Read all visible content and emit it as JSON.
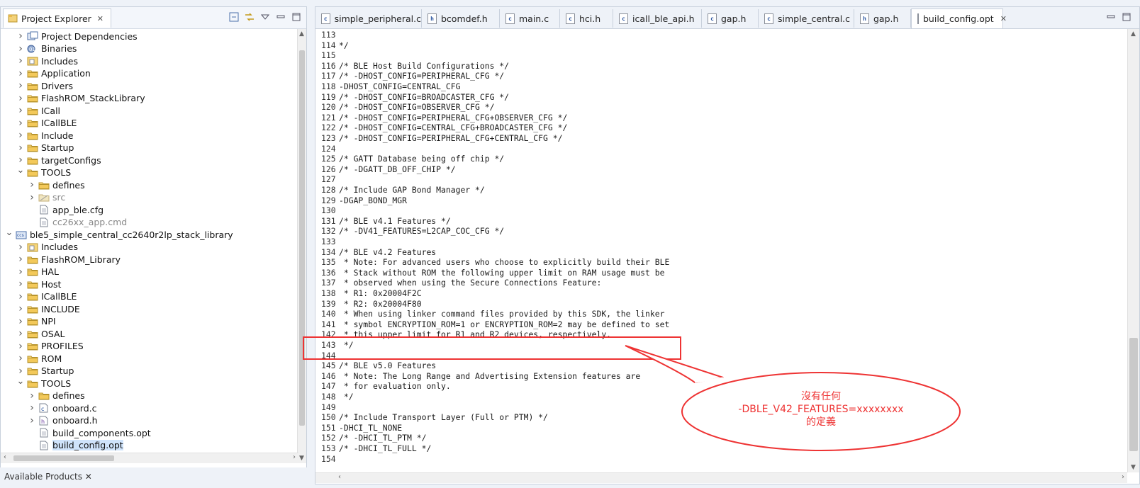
{
  "project_explorer": {
    "title": "Project Explorer",
    "close_glyph": "✕",
    "items": [
      {
        "label": "Project Dependencies",
        "icon": "dependency-icon",
        "state": "collapsed",
        "level": 1
      },
      {
        "label": "Binaries",
        "icon": "binaries-icon",
        "state": "collapsed",
        "level": 1
      },
      {
        "label": "Includes",
        "icon": "includes-icon",
        "state": "collapsed",
        "level": 1
      },
      {
        "label": "Application",
        "icon": "folder-icon",
        "state": "collapsed",
        "level": 1
      },
      {
        "label": "Drivers",
        "icon": "folder-icon",
        "state": "collapsed",
        "level": 1
      },
      {
        "label": "FlashROM_StackLibrary",
        "icon": "folder-icon",
        "state": "collapsed",
        "level": 1
      },
      {
        "label": "ICall",
        "icon": "folder-icon",
        "state": "collapsed",
        "level": 1
      },
      {
        "label": "ICallBLE",
        "icon": "folder-icon",
        "state": "collapsed",
        "level": 1
      },
      {
        "label": "Include",
        "icon": "folder-icon",
        "state": "collapsed",
        "level": 1
      },
      {
        "label": "Startup",
        "icon": "folder-icon",
        "state": "collapsed",
        "level": 1
      },
      {
        "label": "targetConfigs",
        "icon": "folder-icon",
        "state": "collapsed",
        "level": 1
      },
      {
        "label": "TOOLS",
        "icon": "folder-icon",
        "state": "expanded",
        "level": 1
      },
      {
        "label": "defines",
        "icon": "folder-icon",
        "state": "collapsed",
        "level": 2
      },
      {
        "label": "src",
        "icon": "folder-excluded-icon",
        "state": "collapsed",
        "level": 2,
        "dim": true
      },
      {
        "label": "app_ble.cfg",
        "icon": "file-icon",
        "state": "none",
        "level": 2
      },
      {
        "label": "cc26xx_app.cmd",
        "icon": "file-excluded-icon",
        "state": "none",
        "level": 2,
        "dim": true
      },
      {
        "label": "ble5_simple_central_cc2640r2lp_stack_library",
        "icon": "project-icon",
        "state": "expanded",
        "level": 0
      },
      {
        "label": "Includes",
        "icon": "includes-icon",
        "state": "collapsed",
        "level": 1
      },
      {
        "label": "FlashROM_Library",
        "icon": "folder-icon",
        "state": "collapsed",
        "level": 1
      },
      {
        "label": "HAL",
        "icon": "folder-icon",
        "state": "collapsed",
        "level": 1
      },
      {
        "label": "Host",
        "icon": "folder-icon",
        "state": "collapsed",
        "level": 1
      },
      {
        "label": "ICallBLE",
        "icon": "folder-icon",
        "state": "collapsed",
        "level": 1
      },
      {
        "label": "INCLUDE",
        "icon": "folder-icon",
        "state": "collapsed",
        "level": 1
      },
      {
        "label": "NPI",
        "icon": "folder-icon",
        "state": "collapsed",
        "level": 1
      },
      {
        "label": "OSAL",
        "icon": "folder-icon",
        "state": "collapsed",
        "level": 1
      },
      {
        "label": "PROFILES",
        "icon": "folder-icon",
        "state": "collapsed",
        "level": 1
      },
      {
        "label": "ROM",
        "icon": "folder-icon",
        "state": "collapsed",
        "level": 1
      },
      {
        "label": "Startup",
        "icon": "folder-icon",
        "state": "collapsed",
        "level": 1
      },
      {
        "label": "TOOLS",
        "icon": "folder-icon",
        "state": "expanded",
        "level": 1
      },
      {
        "label": "defines",
        "icon": "folder-icon",
        "state": "collapsed",
        "level": 2
      },
      {
        "label": "onboard.c",
        "icon": "c-file-icon",
        "state": "collapsed",
        "level": 2
      },
      {
        "label": "onboard.h",
        "icon": "h-file-icon",
        "state": "collapsed",
        "level": 2
      },
      {
        "label": "build_components.opt",
        "icon": "file-icon",
        "state": "none",
        "level": 2
      },
      {
        "label": "build_config.opt",
        "icon": "file-icon",
        "state": "none",
        "level": 2,
        "selected": true
      }
    ]
  },
  "editor": {
    "tabs": [
      {
        "label": "simple_peripheral.c",
        "icon": "c"
      },
      {
        "label": "bcomdef.h",
        "icon": "h"
      },
      {
        "label": "main.c",
        "icon": "c"
      },
      {
        "label": "hci.h",
        "icon": "c"
      },
      {
        "label": "icall_ble_api.h",
        "icon": "c"
      },
      {
        "label": "gap.h",
        "icon": "c"
      },
      {
        "label": "simple_central.c",
        "icon": "c"
      },
      {
        "label": "gap.h",
        "icon": "h"
      },
      {
        "label": "build_config.opt",
        "icon": "file",
        "active": true
      }
    ],
    "lines": [
      {
        "n": "113",
        "t": ""
      },
      {
        "n": "114",
        "t": "*/"
      },
      {
        "n": "115",
        "t": ""
      },
      {
        "n": "116",
        "t": "/* BLE Host Build Configurations */"
      },
      {
        "n": "117",
        "t": "/* -DHOST_CONFIG=PERIPHERAL_CFG */"
      },
      {
        "n": "118",
        "t": "-DHOST_CONFIG=CENTRAL_CFG"
      },
      {
        "n": "119",
        "t": "/* -DHOST_CONFIG=BROADCASTER_CFG */"
      },
      {
        "n": "120",
        "t": "/* -DHOST_CONFIG=OBSERVER_CFG */"
      },
      {
        "n": "121",
        "t": "/* -DHOST_CONFIG=PERIPHERAL_CFG+OBSERVER_CFG */"
      },
      {
        "n": "122",
        "t": "/* -DHOST_CONFIG=CENTRAL_CFG+BROADCASTER_CFG */"
      },
      {
        "n": "123",
        "t": "/* -DHOST_CONFIG=PERIPHERAL_CFG+CENTRAL_CFG */"
      },
      {
        "n": "124",
        "t": ""
      },
      {
        "n": "125",
        "t": "/* GATT Database being off chip */"
      },
      {
        "n": "126",
        "t": "/* -DGATT_DB_OFF_CHIP */"
      },
      {
        "n": "127",
        "t": ""
      },
      {
        "n": "128",
        "t": "/* Include GAP Bond Manager */"
      },
      {
        "n": "129",
        "t": "-DGAP_BOND_MGR"
      },
      {
        "n": "130",
        "t": ""
      },
      {
        "n": "131",
        "t": "/* BLE v4.1 Features */"
      },
      {
        "n": "132",
        "t": "/* -DV41_FEATURES=L2CAP_COC_CFG */"
      },
      {
        "n": "133",
        "t": ""
      },
      {
        "n": "134",
        "t": "/* BLE v4.2 Features"
      },
      {
        "n": "135",
        "t": " * Note: For advanced users who choose to explicitly build their BLE"
      },
      {
        "n": "136",
        "t": " * Stack without ROM the following upper limit on RAM usage must be"
      },
      {
        "n": "137",
        "t": " * observed when using the Secure Connections Feature:"
      },
      {
        "n": "138",
        "t": " * R1: 0x20004F2C"
      },
      {
        "n": "139",
        "t": " * R2: 0x20004F80"
      },
      {
        "n": "140",
        "t": " * When using linker command files provided by this SDK, the linker"
      },
      {
        "n": "141",
        "t": " * symbol ENCRYPTION_ROM=1 or ENCRYPTION_ROM=2 may be defined to set"
      },
      {
        "n": "142",
        "t": " * this upper limit for R1 and R2 devices, respectively."
      },
      {
        "n": "143",
        "t": " */"
      },
      {
        "n": "144",
        "t": ""
      },
      {
        "n": "145",
        "t": "/* BLE v5.0 Features"
      },
      {
        "n": "146",
        "t": " * Note: The Long Range and Advertising Extension features are"
      },
      {
        "n": "147",
        "t": " * for evaluation only."
      },
      {
        "n": "148",
        "t": " */"
      },
      {
        "n": "149",
        "t": ""
      },
      {
        "n": "150",
        "t": "/* Include Transport Layer (Full or PTM) */"
      },
      {
        "n": "151",
        "t": "-DHCI_TL_NONE"
      },
      {
        "n": "152",
        "t": "/* -DHCI_TL_PTM */"
      },
      {
        "n": "153",
        "t": "/* -DHCI_TL_FULL */"
      },
      {
        "n": "154",
        "t": ""
      }
    ]
  },
  "annotation": {
    "line1": "沒有任何",
    "line2": "-DBLE_V42_FEATURES=xxxxxxxx",
    "line3": "的定義",
    "color": "#e33333"
  },
  "bottom_panel": {
    "tab_label": "Available Products ✕"
  }
}
